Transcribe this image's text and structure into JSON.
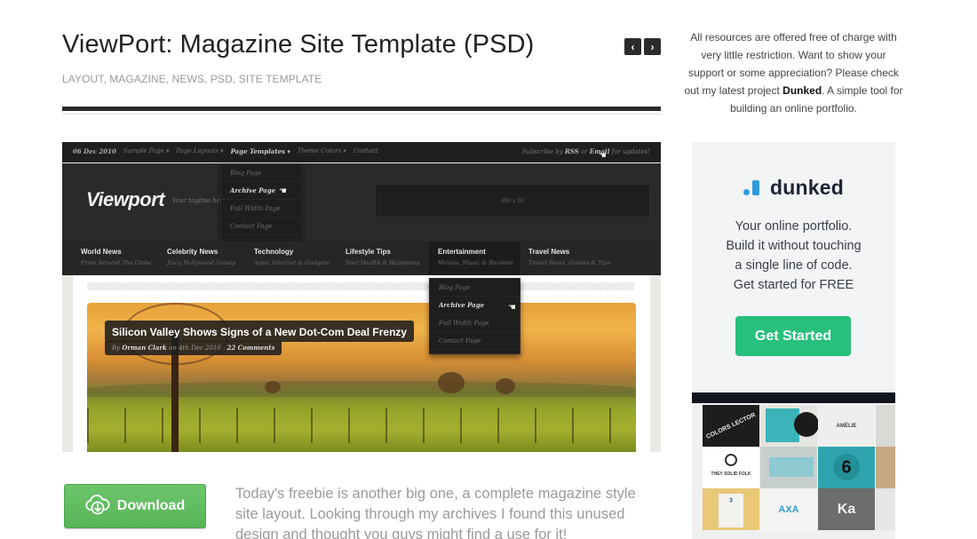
{
  "post": {
    "title": "ViewPort: Magazine Site Template (PSD)",
    "tags": [
      "LAYOUT",
      "MAGAZINE",
      "NEWS",
      "PSD",
      "SITE TEMPLATE"
    ],
    "nav": {
      "prev_label": "‹",
      "next_label": "›"
    }
  },
  "preview": {
    "topbar": {
      "date": "06 Dec 2010",
      "links": [
        "Sample Page ▾",
        "Page Layouts ▾",
        "Page Templates ▾",
        "Theme Colors ▾",
        "Contact"
      ],
      "active_link_index": 2,
      "subscribe_prefix": "Subscribe by",
      "subscribe_rss": "RSS",
      "subscribe_or": "or",
      "subscribe_email": "Email",
      "subscribe_suffix": "for updates!"
    },
    "logo": "Viewport",
    "tagline": "Your tagline here",
    "ad_placeholder": "468 x 60",
    "template_dropdown": [
      "Blog Page",
      "Archive Page",
      "Full Width Page",
      "Contact Page"
    ],
    "template_dropdown_active": 1,
    "menu": [
      {
        "title": "World News",
        "sub": "From Around The Globe"
      },
      {
        "title": "Celebrity News",
        "sub": "Juicy Hollywood Gossip"
      },
      {
        "title": "Technology",
        "sub": "Apps, Internet & Gadgets"
      },
      {
        "title": "Lifestyle Tips",
        "sub": "Your Health & Happiness"
      },
      {
        "title": "Entertainment",
        "sub": "Movies, Music & Reviews"
      },
      {
        "title": "Travel News",
        "sub": "Travel News, Guides & Tips"
      }
    ],
    "entertainment_dropdown": [
      "Blog Page",
      "Archive Page",
      "Full Width Page",
      "Contact Page"
    ],
    "entertainment_dropdown_active": 1,
    "feature": {
      "title": "Silicon Valley Shows Signs of a New Dot-Com Deal Frenzy",
      "meta_by": "By",
      "meta_author": "Orman Clark",
      "meta_date": "on 4th Dec 2010 ·",
      "meta_comments": "22 Comments"
    }
  },
  "download": {
    "label": "Download",
    "icon": "cloud-download-icon",
    "color": "#5cb85c"
  },
  "intro": "Today's freebie is another big one, a complete magazine style site layout. Looking through my archives I found this unused design and thought you guys might find a use for it!",
  "sidebar": {
    "support_text_before": "All resources are offered free of charge with very little restriction. Want to show your support or some appreciation? Please check out my latest project ",
    "support_link": "Dunked",
    "support_text_after": ". A simple tool for building an online portfolio.",
    "ad": {
      "brand": "dunked",
      "brand_color": "#2d9cdb",
      "lines": [
        "Your online portfolio.",
        "Build it without touching",
        "a single line of code.",
        "Get started for FREE"
      ],
      "cta": "Get Started",
      "cta_color": "#27c07d"
    },
    "portfolio_tiles": [
      "COLORS LECTOR",
      "",
      "AMÉLIE",
      "THEY SOLID FOLK",
      "",
      "6",
      "3",
      "AXA",
      "Ka"
    ]
  }
}
